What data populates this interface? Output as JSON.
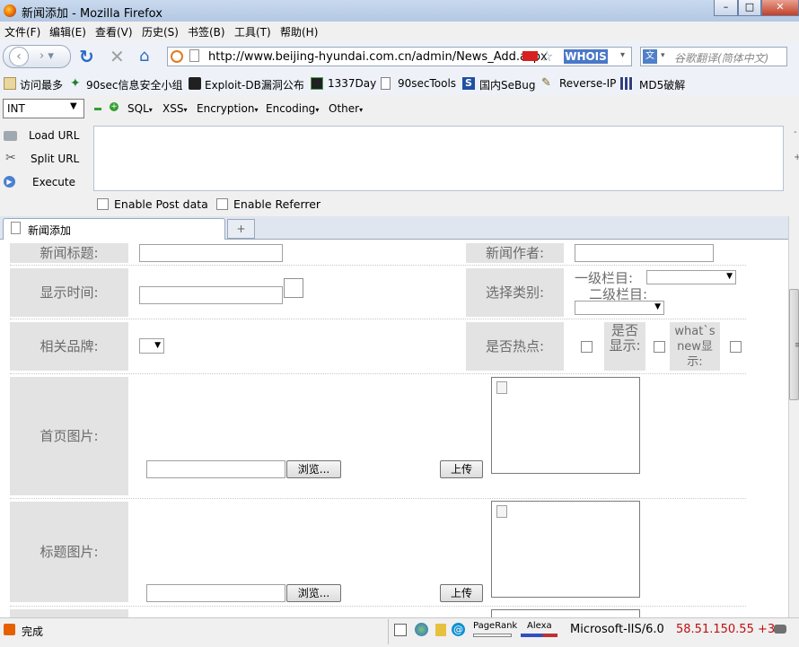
{
  "window": {
    "title": "新闻添加 - Mozilla Firefox"
  },
  "menu": [
    "文件(F)",
    "编辑(E)",
    "查看(V)",
    "历史(S)",
    "书签(B)",
    "工具(T)",
    "帮助(H)"
  ],
  "nav": {
    "url": "http://www.beijing-hyundai.com.cn/admin/News_Add.aspx",
    "whois": "WHOIS",
    "search_placeholder": "谷歌翻译(简体中文)"
  },
  "bookmarks": [
    "访问最多",
    "90sec信息安全小组",
    "Exploit-DB漏洞公布",
    "1337Day",
    "90secTools",
    "国内SeBug",
    "Reverse-IP",
    "MD5破解"
  ],
  "hackbar": {
    "int_select": "INT",
    "menus": [
      "SQL",
      "XSS",
      "Encryption",
      "Encoding",
      "Other"
    ],
    "load_url": "Load URL",
    "split_url": "Split URL",
    "execute": "Execute",
    "enable_post": "Enable Post data",
    "enable_referrer": "Enable Referrer"
  },
  "tab": {
    "label": "新闻添加"
  },
  "form": {
    "title_label": "新闻标题:",
    "author_label": "新闻作者:",
    "time_label": "显示时间:",
    "category_label": "选择类别:",
    "cat1_label": "一级栏目:",
    "cat2_label": "二级栏目:",
    "brand_label": "相关品牌:",
    "hot_label": "是否热点:",
    "show_label": "是否显示:",
    "whats_new_label": "what`s new显示:",
    "home_img_label": "首页图片:",
    "title_img_label": "标题图片:",
    "browse": "浏览...",
    "upload": "上传"
  },
  "status": {
    "text": "完成",
    "pagerank": "PageRank",
    "alexa": "Alexa",
    "server": "Microsoft-IIS/6.0",
    "ip": "58.51.150.55 +3"
  }
}
